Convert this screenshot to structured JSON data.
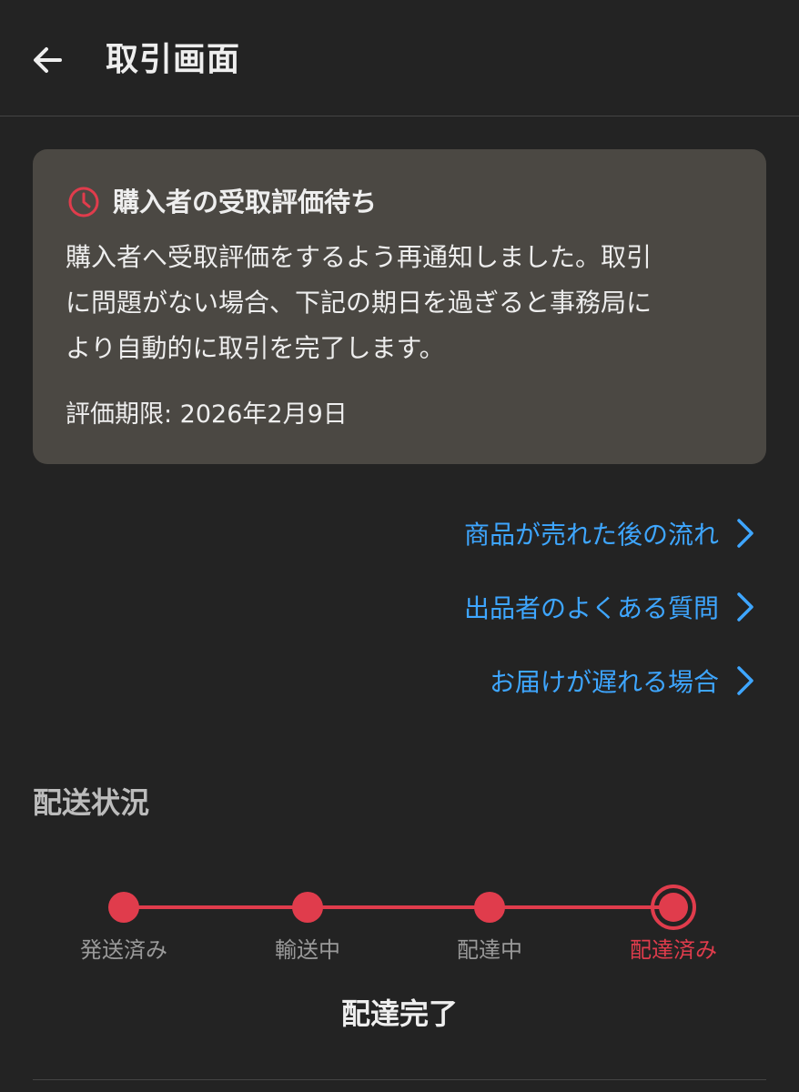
{
  "header": {
    "title": "取引画面",
    "back_icon": "arrow-left-icon"
  },
  "status_card": {
    "icon": "clock-icon",
    "icon_color": "#e03c4c",
    "title": "購入者の受取評価待ち",
    "lines": [
      "購入者へ受取評価をするよう再通知しました。取引",
      "に問題がない場合、下記の期日を過ぎると事務局に",
      "より自動的に取引を完了します。"
    ],
    "deadline": "評価期限: 2026年2月9日"
  },
  "links": [
    {
      "label": "商品が売れた後の流れ",
      "icon": "chevron-right-icon"
    },
    {
      "label": "出品者のよくある質問",
      "icon": "chevron-right-icon"
    },
    {
      "label": "お届けが遅れる場合",
      "icon": "chevron-right-icon"
    }
  ],
  "delivery": {
    "section_title": "配送状況",
    "steps": [
      {
        "label": "発送済み"
      },
      {
        "label": "輸送中"
      },
      {
        "label": "配達中"
      },
      {
        "label": "配達済み",
        "current": true
      }
    ],
    "status_text": "配達完了"
  },
  "colors": {
    "accent": "#e03c4c",
    "link": "#3ea6ff",
    "background": "#232323",
    "card": "#4b4843"
  }
}
